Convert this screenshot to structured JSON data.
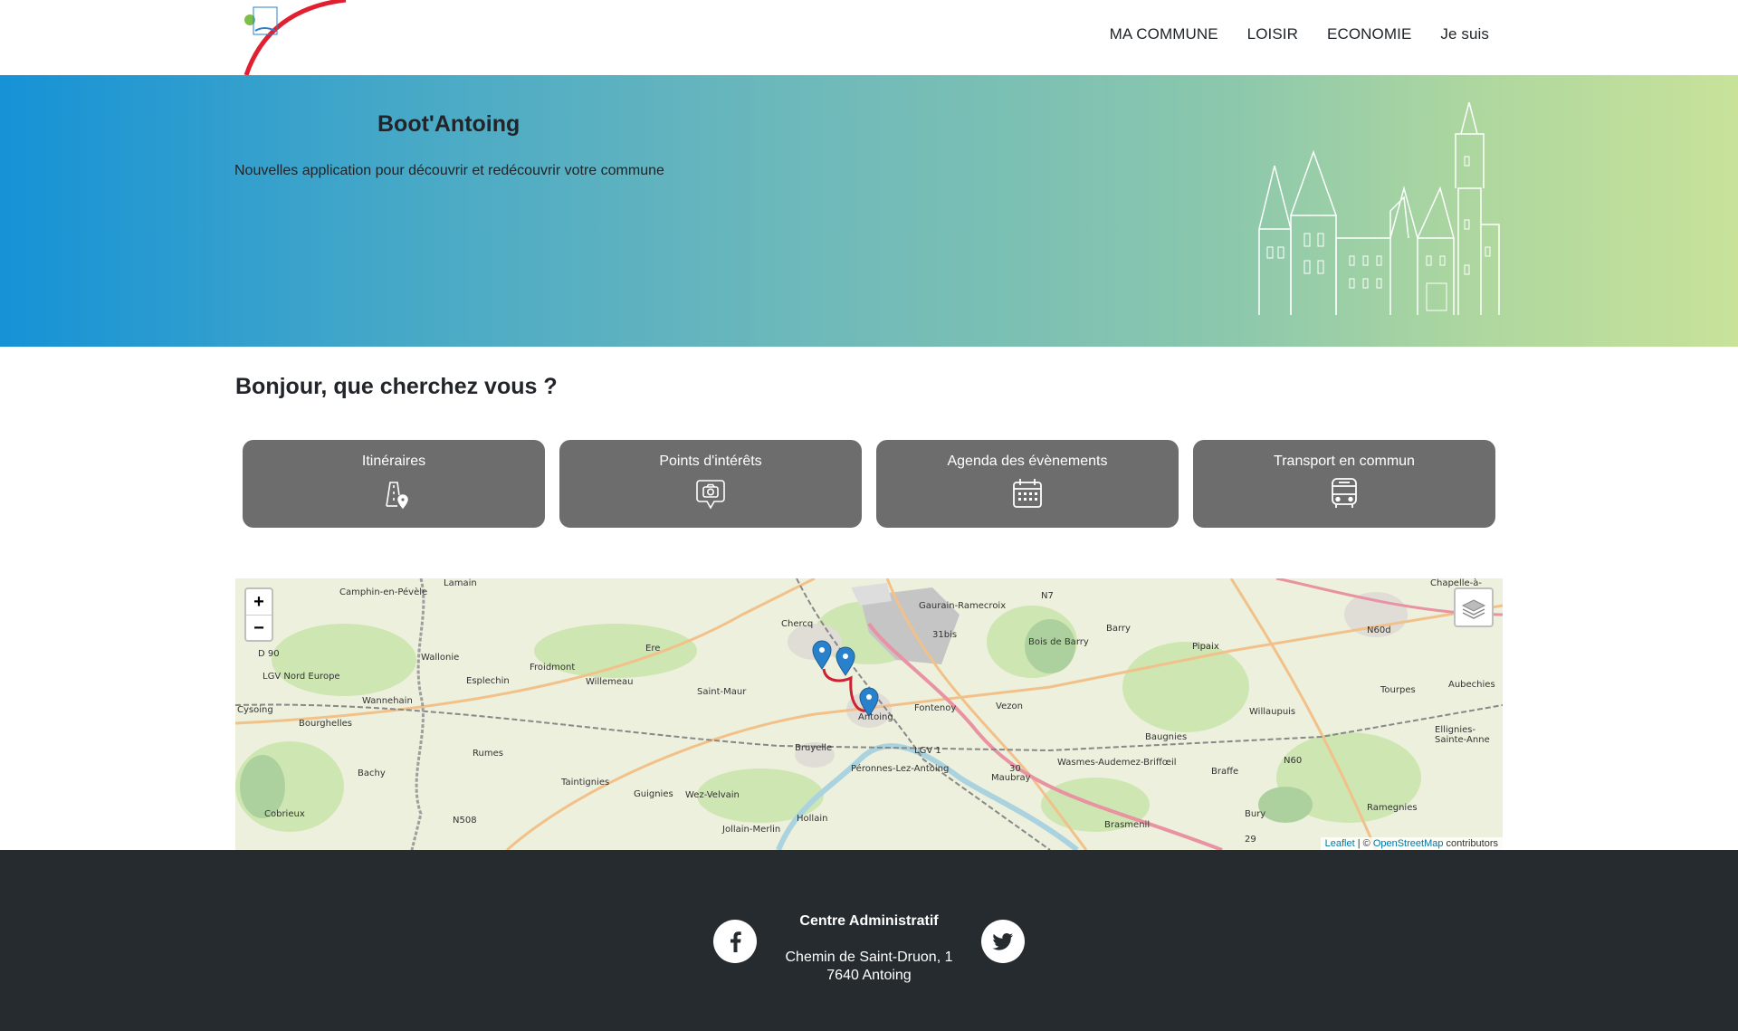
{
  "nav": {
    "items": [
      "MA COMMUNE",
      "LOISIR",
      "ECONOMIE",
      "Je suis"
    ]
  },
  "hero": {
    "title": "Boot'Antoing",
    "subtitle": "Nouvelles application pour découvrir et redécouvrir votre commune"
  },
  "question": "Bonjour, que cherchez vous ?",
  "cards": [
    {
      "label": "Itinéraires",
      "icon": "route-pin-icon"
    },
    {
      "label": "Points d'intérêts",
      "icon": "camera-pin-icon"
    },
    {
      "label": "Agenda des évènements",
      "icon": "calendar-icon"
    },
    {
      "label": "Transport en commun",
      "icon": "bus-icon"
    }
  ],
  "map": {
    "zoom_in": "+",
    "zoom_out": "−",
    "attribution_leaflet": "Leaflet",
    "attribution_sep": " | © ",
    "attribution_osm": "OpenStreetMap",
    "attribution_tail": " contributors",
    "labels": [
      "Lamain",
      "Camphin-en-Pévèle",
      "Chercq",
      "Gaurain-Ramecroix",
      "N7",
      "Barry",
      "Pipaix",
      "Chapelle-à-",
      "D 90",
      "LGV Nord Europe",
      "Ere",
      "Froidmont",
      "Esplechin",
      "Willemeau",
      "Saint-Maur",
      "Fontenoy",
      "Vezon",
      "Willaupuis",
      "Tourpes",
      "Aubechies",
      "N60d",
      "Cysoing",
      "Wannehain",
      "Antoing",
      "Bourghelles",
      "Baugnies",
      "Ellignies-Sainte-Anne",
      "Rumes",
      "Bruyelle",
      "LGV 1",
      "Péronnes-Lez-Antoing",
      "Wasmes-Audemez-Briffœil",
      "Maubray",
      "Braffe",
      "N60",
      "Bachy",
      "Taintignies",
      "Guignies",
      "Wez-Velvain",
      "Ramegnies",
      "Cobrieux",
      "N508",
      "Hollain",
      "Jollain-Merlin",
      "Brasmenil",
      "Bury",
      "Wallonie",
      "Bois de Barry",
      "31bis",
      "30",
      "29"
    ]
  },
  "footer": {
    "title": "Centre Administratif",
    "address_line1": "Chemin de Saint-Druon, 1",
    "address_line2": "7640 Antoing"
  },
  "colors": {
    "hero_start": "#1692d6",
    "hero_end": "#c8e29a",
    "card_bg": "#6d6d6d",
    "footer_bg": "#252b2e",
    "route": "#cc2233",
    "marker": "#2a81cb"
  }
}
